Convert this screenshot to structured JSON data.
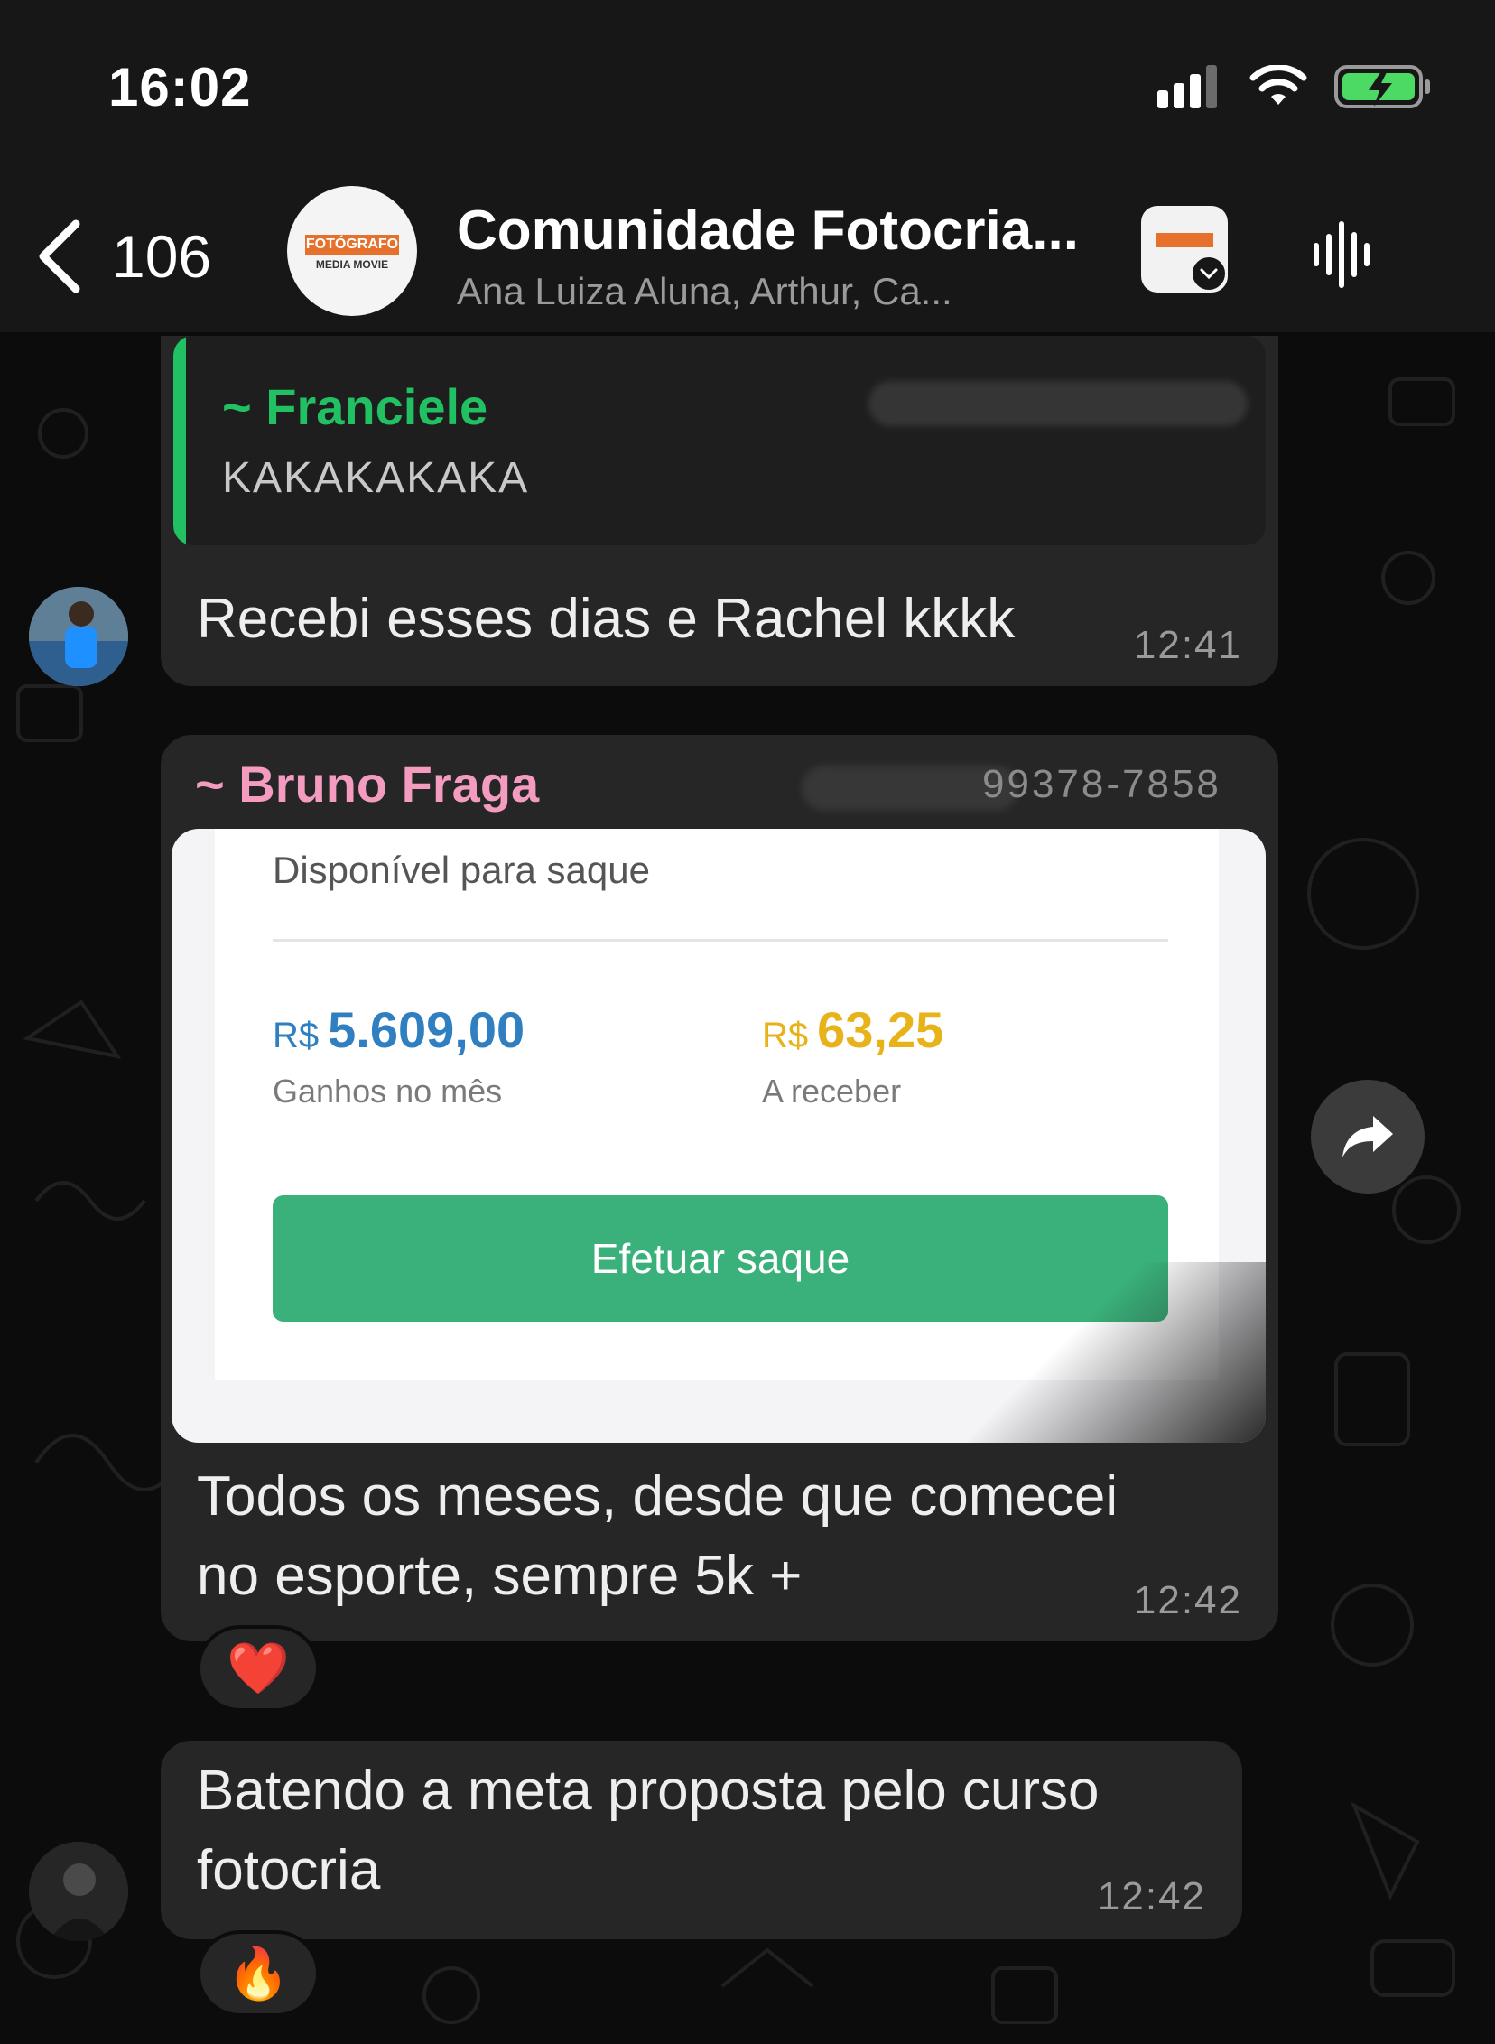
{
  "status_bar": {
    "time": "16:02",
    "signal_icon": "cellular-signal-icon",
    "wifi_icon": "wifi-icon",
    "battery_icon": "battery-charging-icon"
  },
  "header": {
    "back_count": "106",
    "title": "Comunidade Fotocria...",
    "members": "Ana Luiza Aluna, Arthur, Ca...",
    "avatar_logo_top": "FOTÓGRAFO",
    "avatar_logo_bottom": "MEDIA MOVIE"
  },
  "messages": [
    {
      "quote_author": "~ Franciele",
      "quote_text": "KAKAKAKAKA",
      "text": "Recebi esses dias e Rachel kkkk",
      "time": "12:41"
    },
    {
      "sender": "~ Bruno Fraga",
      "sender_phone_partial": "99378-7858",
      "image": {
        "heading": "Disponível para saque",
        "earned_currency": "R$",
        "earned_value": "5.609,00",
        "earned_label": "Ganhos no mês",
        "pending_currency": "R$",
        "pending_value": "63,25",
        "pending_label": "A receber",
        "button_label": "Efetuar saque"
      },
      "text_line1": "Todos os meses, desde que comecei",
      "text_line2": "no esporte, sempre 5k +",
      "time": "12:42",
      "reaction": "❤️"
    },
    {
      "text_line1": "Batendo a meta proposta pelo curso",
      "text_line2": "fotocria",
      "time": "12:42",
      "reaction": "🔥"
    }
  ],
  "colors": {
    "accent_green": "#21c063",
    "sender_pink": "#f39cc0",
    "earned_blue": "#2f7fc1",
    "pending_gold": "#e8b21b",
    "button_green": "#3ab07a"
  }
}
